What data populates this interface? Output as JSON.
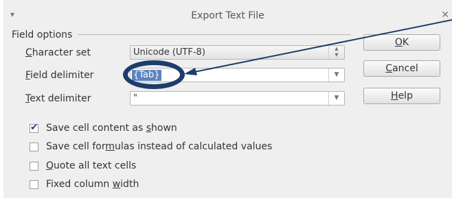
{
  "window": {
    "title": "Export Text File",
    "menu_icon": "chevron-down-icon",
    "menu_glyph": "▾",
    "close_icon": "close-icon",
    "close_glyph": "✕"
  },
  "field_options": {
    "group_label": "Field options",
    "character_set": {
      "label_rest": "haracter set",
      "mnemonic": "C",
      "value": "Unicode (UTF-8)"
    },
    "field_delimiter": {
      "label_rest": "ield delimiter",
      "mnemonic": "F",
      "value": "{Tab}"
    },
    "text_delimiter": {
      "label_rest": "ext delimiter",
      "mnemonic": "T",
      "value": "\""
    }
  },
  "checkboxes": [
    {
      "before": "Save cell content as ",
      "mnemonic": "s",
      "after": "hown",
      "checked": true
    },
    {
      "before": "Save cell for",
      "mnemonic": "m",
      "after": "ulas instead of calculated values",
      "checked": false
    },
    {
      "before": "",
      "mnemonic": "Q",
      "after": "uote all text cells",
      "checked": false
    },
    {
      "before": "Fixed column ",
      "mnemonic": "w",
      "after": "idth",
      "checked": false
    }
  ],
  "buttons": {
    "ok": {
      "mnemonic": "O",
      "rest": "K"
    },
    "cancel": {
      "mnemonic": "C",
      "rest": "ancel"
    },
    "help": {
      "mnemonic": "H",
      "rest": "elp"
    }
  },
  "annotation": {
    "color": "#1d3d6b"
  },
  "glyphs": {
    "dropdown": "▼",
    "spin_up": "▲",
    "spin_down": "▼",
    "check": "✔"
  }
}
